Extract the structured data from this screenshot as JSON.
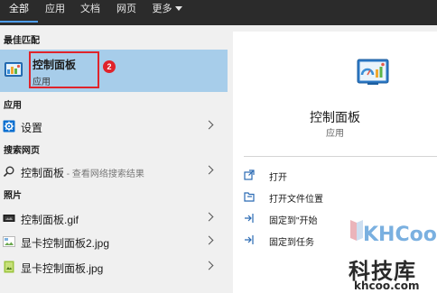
{
  "tabs": [
    {
      "label": "全部",
      "active": true
    },
    {
      "label": "应用",
      "active": false
    },
    {
      "label": "文档",
      "active": false
    },
    {
      "label": "网页",
      "active": false
    },
    {
      "label": "更多",
      "active": false
    }
  ],
  "sections": {
    "best_match": "最佳匹配",
    "apps": "应用",
    "web": "搜索网页",
    "photos": "照片"
  },
  "best_match": {
    "title": "控制面板",
    "subtitle": "应用",
    "badge": "2",
    "icon": "control-panel-icon"
  },
  "apps": [
    {
      "label": "设置",
      "icon": "gear-icon"
    }
  ],
  "web": [
    {
      "label": "控制面板",
      "suffix": " - 查看网络搜索结果",
      "icon": "search-icon"
    }
  ],
  "photos": [
    {
      "label": "控制面板.gif",
      "icon": "image-file-icon"
    },
    {
      "label": "显卡控制面板2.jpg",
      "icon": "image-file-icon"
    },
    {
      "label": "显卡控制面板.jpg",
      "icon": "image-file-icon"
    }
  ],
  "detail": {
    "title": "控制面板",
    "subtitle": "应用",
    "actions": [
      {
        "label": "打开",
        "icon": "open-icon"
      },
      {
        "label": "打开文件位置",
        "icon": "folder-location-icon"
      },
      {
        "label": "固定到\"开始",
        "icon": "pin-icon"
      },
      {
        "label": "固定到任务",
        "icon": "pin-icon"
      }
    ]
  },
  "watermark": {
    "brand": "KHCoo",
    "chinese": "科技库",
    "domain": "khcoo.com"
  },
  "colors": {
    "topbar": "#2b2b2b",
    "selection": "#a7cdea",
    "highlight_border": "#e0232b",
    "tab_underline": "#4f9ef3"
  }
}
